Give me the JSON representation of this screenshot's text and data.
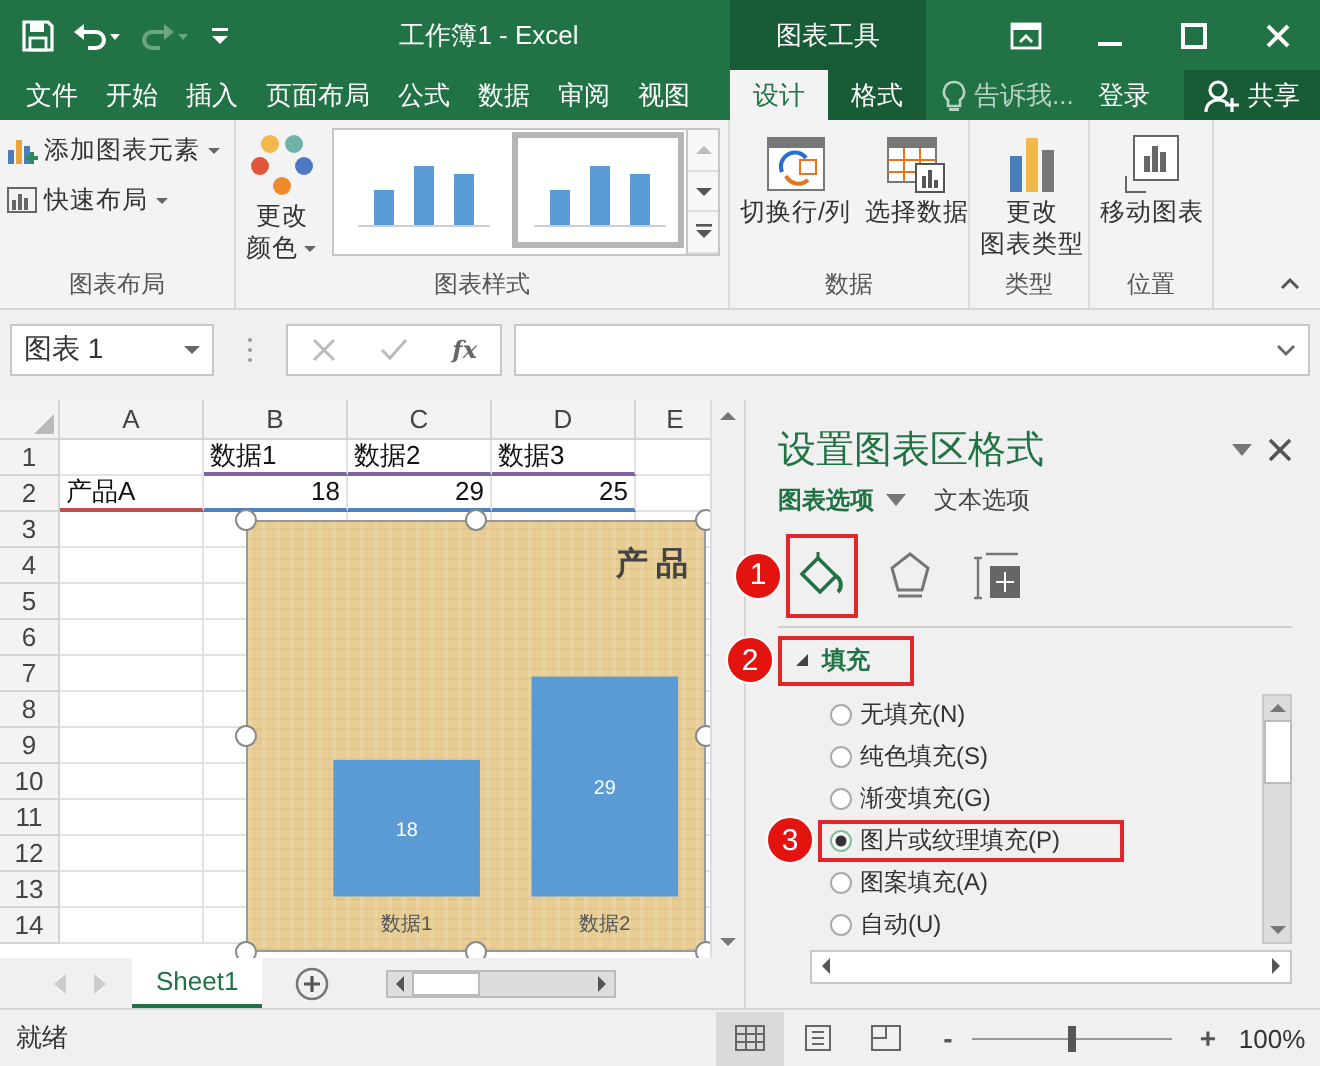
{
  "title_bar": {
    "title": "工作簿1 - Excel",
    "context_label": "图表工具"
  },
  "ribbon_tabs": [
    {
      "label": "文件",
      "selected": false,
      "contextual": false
    },
    {
      "label": "开始",
      "selected": false,
      "contextual": false
    },
    {
      "label": "插入",
      "selected": false,
      "contextual": false
    },
    {
      "label": "页面布局",
      "selected": false,
      "contextual": false
    },
    {
      "label": "公式",
      "selected": false,
      "contextual": false
    },
    {
      "label": "数据",
      "selected": false,
      "contextual": false
    },
    {
      "label": "审阅",
      "selected": false,
      "contextual": false
    },
    {
      "label": "视图",
      "selected": false,
      "contextual": false
    },
    {
      "label": "设计",
      "selected": true,
      "contextual": true
    },
    {
      "label": "格式",
      "selected": false,
      "contextual": true
    }
  ],
  "tell_me": "告诉我...",
  "sign_in": "登录",
  "share": "共享",
  "ribbon": {
    "groups": [
      {
        "label": "图表布局",
        "buttons": [
          {
            "lines": [
              "添加图表元素"
            ],
            "dropdown": true
          },
          {
            "lines": [
              "快速布局"
            ],
            "dropdown": true
          }
        ]
      },
      {
        "label": "图表样式",
        "buttons": [
          {
            "lines": [
              "更改",
              "颜色"
            ],
            "dropdown": true
          }
        ],
        "styles": [
          {
            "selected": false
          },
          {
            "selected": true
          }
        ]
      },
      {
        "label": "数据",
        "buttons": [
          {
            "lines": [
              "切换行/列"
            ]
          },
          {
            "lines": [
              "选择数据"
            ]
          }
        ]
      },
      {
        "label": "类型",
        "buttons": [
          {
            "lines": [
              "更改",
              "图表类型"
            ]
          }
        ]
      },
      {
        "label": "位置",
        "buttons": [
          {
            "lines": [
              "移动图表"
            ]
          }
        ]
      }
    ]
  },
  "formula_bar": {
    "name_box": "图表 1",
    "function_label": "fx"
  },
  "sheet": {
    "columns": [
      "A",
      "B",
      "C",
      "D",
      "E"
    ],
    "rows": [
      {
        "number": "1",
        "cells": [
          null,
          {
            "text": "数据1",
            "kind": "text",
            "color": "#8064a2"
          },
          {
            "text": "数据2",
            "kind": "text",
            "color": "#8064a2"
          },
          {
            "text": "数据3",
            "kind": "text",
            "color": "#8064a2"
          },
          null
        ]
      },
      {
        "number": "2",
        "cells": [
          {
            "text": "产品A",
            "kind": "text",
            "color": "#c0504d"
          },
          {
            "text": "18",
            "kind": "number",
            "color": "#4f81bd"
          },
          {
            "text": "29",
            "kind": "number",
            "color": "#4f81bd"
          },
          {
            "text": "25",
            "kind": "number",
            "color": "#4f81bd"
          },
          null
        ]
      },
      {
        "number": "3"
      },
      {
        "number": "4"
      },
      {
        "number": "5"
      },
      {
        "number": "6"
      },
      {
        "number": "7"
      },
      {
        "number": "8"
      },
      {
        "number": "9"
      },
      {
        "number": "10"
      },
      {
        "number": "11"
      },
      {
        "number": "12"
      },
      {
        "number": "13"
      },
      {
        "number": "14"
      }
    ]
  },
  "chart": {
    "chart_data": {
      "type": "bar",
      "title": "产品",
      "categories": [
        "数据1",
        "数据2"
      ],
      "values": [
        18,
        29
      ],
      "data_labels": true
    }
  },
  "sheet_tabs": [
    {
      "label": "Sheet1",
      "selected": true
    }
  ],
  "format_pane": {
    "title": "设置图表区格式",
    "tabs": [
      {
        "label": "图表选项",
        "selected": true,
        "dropdown": true
      },
      {
        "label": "文本选项",
        "selected": false
      }
    ],
    "icon_tabs": [
      {
        "selected": true,
        "callout": "1"
      },
      {
        "selected": false
      },
      {
        "selected": false
      }
    ],
    "section": {
      "label": "填充",
      "expanded": true,
      "callout": "2"
    },
    "options": [
      {
        "label": "无填充(N)",
        "selected": false
      },
      {
        "label": "纯色填充(S)",
        "selected": false
      },
      {
        "label": "渐变填充(G)",
        "selected": false
      },
      {
        "label": "图片或纹理填充(P)",
        "selected": true,
        "callout": "3"
      },
      {
        "label": "图案填充(A)",
        "selected": false
      },
      {
        "label": "自动(U)",
        "selected": false
      }
    ]
  },
  "status_bar": {
    "text": "就绪",
    "views": [
      {
        "selected": true
      },
      {
        "selected": false
      },
      {
        "selected": false
      }
    ],
    "zoom": {
      "minus": "-",
      "plus": "+",
      "level": 0.5,
      "reading": "100%"
    }
  }
}
